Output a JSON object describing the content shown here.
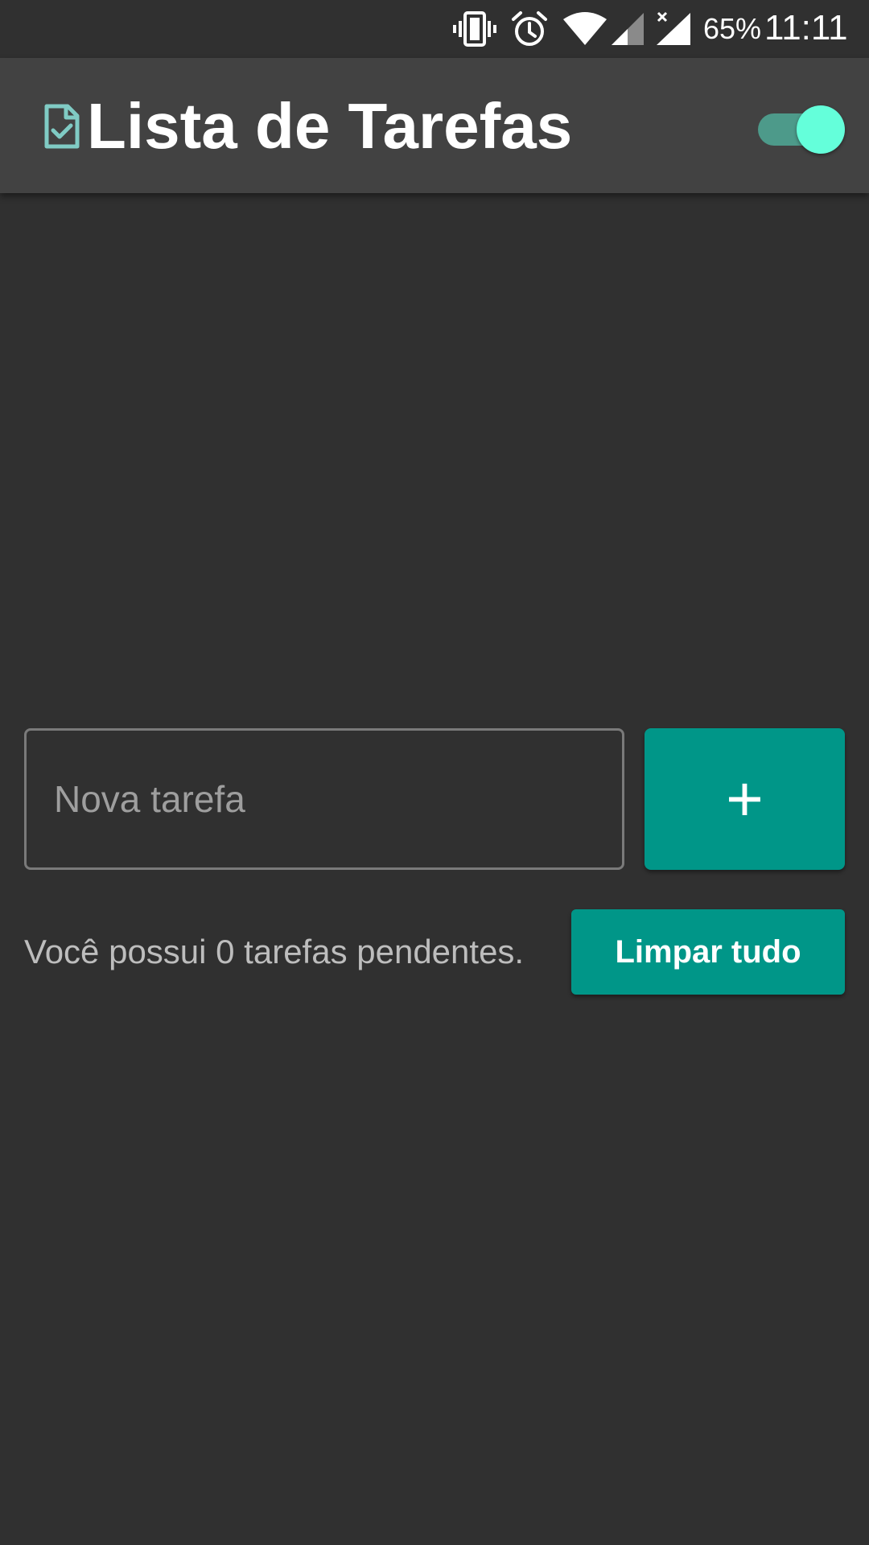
{
  "status_bar": {
    "battery": "65%",
    "time": "11:11",
    "icons": [
      "vibrate-icon",
      "alarm-icon",
      "wifi-icon",
      "signal-icon",
      "signal-no-service-icon"
    ]
  },
  "app_bar": {
    "title": "Lista de Tarefas",
    "title_icon": "document-check-icon",
    "theme_toggle_on": true
  },
  "task_form": {
    "input_placeholder": "Nova tarefa",
    "input_value": "",
    "add_label": "+"
  },
  "summary": {
    "pending_text": "Você possui 0 tarefas pendentes.",
    "clear_label": "Limpar tudo"
  },
  "colors": {
    "background": "#303030",
    "app_bar": "#424242",
    "accent": "#009688",
    "toggle_thumb": "#64ffda",
    "icon_tint": "#80cbc4"
  }
}
